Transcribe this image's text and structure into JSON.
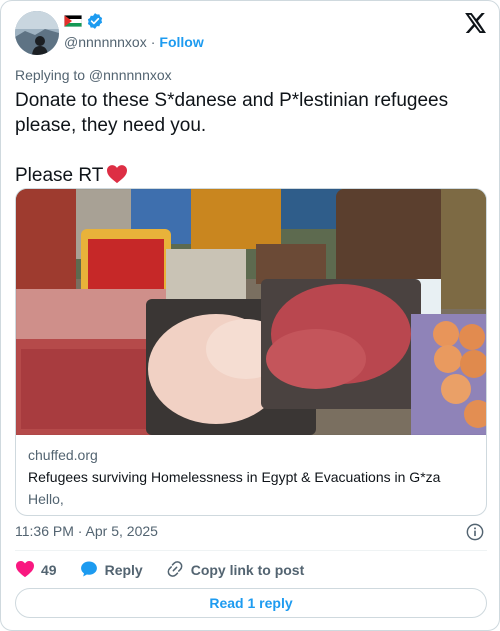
{
  "author": {
    "handle": "@nnnnnnxox",
    "separator": "·",
    "follow_label": "Follow",
    "flag_icon": "palestine-flag-icon",
    "verified_icon": "verified-badge-icon"
  },
  "replying_to": "Replying to @nnnnnnxox",
  "tweet": {
    "line1": "Donate to these S*danese and P*lestinian refugees",
    "line2": "please, they need you.",
    "line3": "Please RT"
  },
  "link_card": {
    "domain": "chuffed.org",
    "title": "Refugees surviving Homelessness in Egypt & Evacuations in G*za",
    "description": "Hello,"
  },
  "timestamp": "11:36 PM · Apr 5, 2025",
  "actions": {
    "like_count": "49",
    "reply_label": "Reply",
    "copy_label": "Copy link to post"
  },
  "read_replies_label": "Read 1 reply",
  "colors": {
    "accent": "#1d9bf0",
    "like": "#f91880",
    "muted": "#536471",
    "border": "#cfd9de"
  }
}
